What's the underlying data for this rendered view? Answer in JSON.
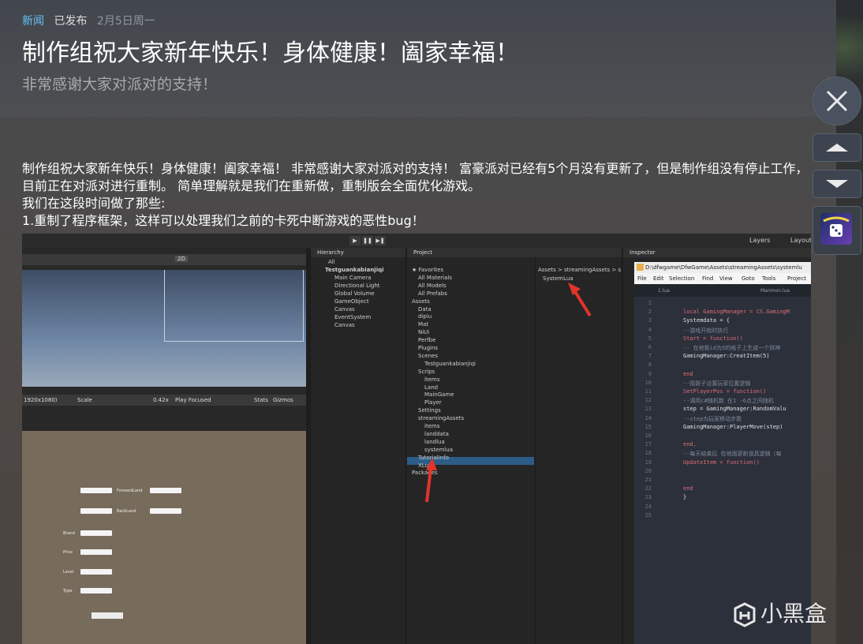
{
  "post": {
    "tag": "新闻",
    "status": "已发布",
    "date": "2月5日周一",
    "title": "制作组祝大家新年快乐！身体健康！阖家幸福！",
    "subtitle": "非常感谢大家对派对的支持！",
    "body": [
      "制作组祝大家新年快乐！身体健康！阖家幸福！ 非常感谢大家对派对的支持！ 富豪派对已经有5个月没有更新了，但是制作组没有停止工作，目前正在对派对进行重制。 简单理解就是我们在重新做，重制版会全面优化游戏。",
      "我们在这段时间做了那些:",
      "1.重制了程序框架，这样可以处理我们之前的卡死中断游戏的恶性bug！"
    ]
  },
  "screenshot": {
    "top_right": [
      "Layers",
      "Layout"
    ],
    "scene_bar_left": "2D",
    "game_bar": [
      "1920x1080)",
      "Scale",
      "0.42x",
      "Play Focused",
      "Stats",
      "Gizmos"
    ],
    "game_labels": [
      "ForwardLand",
      "BackLand",
      "Brand",
      "Price",
      "Level",
      "Type"
    ],
    "hierarchy": {
      "tab": "Hierarchy",
      "search": "All",
      "root": "Testguankabianjiqi",
      "items": [
        "Main Camera",
        "Directional Light",
        "Global Volume",
        "GameObject",
        "Canvas",
        "EventSystem",
        "Canvas"
      ]
    },
    "project": {
      "tab": "Project",
      "breadcrumb": "Assets > streamingAssets > s",
      "file": "SystemLua",
      "tree": [
        "★ Favorites",
        "All Materials",
        "All Models",
        "All Prefabs",
        "Assets",
        "Data",
        "dipiu",
        "Mat",
        "NiUi",
        "Perfbe",
        "Plugins",
        "Scenes",
        "Testguankabianjiqi",
        "Scrips",
        "items",
        "Land",
        "MainGame",
        "Player",
        "Settings",
        "streamingAssets",
        "items",
        "landdata",
        "landlua",
        "systemlua",
        "TutorialInfo",
        "XLua",
        "Packages"
      ]
    },
    "inspector": {
      "tab": "Inspector"
    },
    "editor": {
      "path": "D:\\dfwgame\\DfwGame\\Assets\\streamingAssets\\systemlu",
      "menu": [
        "File",
        "Edit",
        "Selection",
        "Find",
        "View",
        "Goto",
        "Tools",
        "Project"
      ],
      "tabs": [
        "1.lua",
        "Manmon.lua"
      ],
      "line_numbers": [
        "1",
        "2",
        "3",
        "4",
        "5",
        "6",
        "7",
        "8",
        "9",
        "10",
        "11",
        "12",
        "13",
        "14",
        "15",
        "16",
        "17",
        "18",
        "19",
        "20",
        "21",
        "22",
        "23",
        "24",
        "25"
      ],
      "lines": [
        "",
        "local GamingManager = CS.GamingM",
        "Systemdata = {",
        "--游戏开始时执行",
        "Start = function()",
        "-- 在地板id为5的格子上生成一个财神",
        "GamingManager:CreatItem(5)",
        "",
        "end",
        "--摇骰子设置玩家位置逻辑",
        "SetPlayerPos = function()",
        "--调用c#随机数 在1 -6点之间随机",
        "step = GamingManager:RandomValu",
        "--step为玩家移动步数",
        "GamingManager:PlayerMove(step)",
        "",
        "end,",
        "--每天结束后 在地面更新道具逻辑（每",
        "UpdateItem = function()",
        "",
        "",
        "end",
        "}",
        "",
        ""
      ]
    }
  },
  "watermark": "小黑盒",
  "controls": {
    "close": "close",
    "prev": "previous",
    "next": "next"
  },
  "colors": {
    "tag": "#66c0f4",
    "title": "#ffffff",
    "subtitle": "#a9a9a9",
    "selection": "#2c5d87",
    "arrow": "#e2342b"
  }
}
